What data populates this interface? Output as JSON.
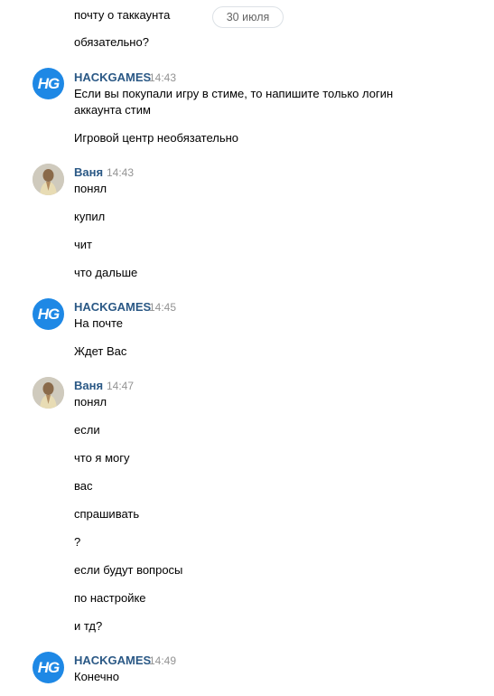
{
  "date_divider": "30 июля",
  "top_lines": [
    "почту о таккаунта",
    "обязательно?"
  ],
  "groups": [
    {
      "author": "HACKGAMES",
      "time": "14:43",
      "avatar_text": "HG",
      "messages": [
        "Если вы покупали игру в стиме, то напишите только логин",
        "аккаунта стим",
        "Игровой центр необязательно"
      ]
    },
    {
      "author": "Ваня",
      "time": "14:43",
      "messages": [
        "понял",
        "купил",
        "чит",
        "что дальше"
      ]
    },
    {
      "author": "HACKGAMES",
      "time": "14:45",
      "avatar_text": "HG",
      "messages": [
        "На почте",
        "Ждет Вас"
      ]
    },
    {
      "author": "Ваня",
      "time": "14:47",
      "messages": [
        "понял",
        "если",
        "что я могу",
        "вас",
        "спрашивать",
        "?",
        "если будут вопросы",
        "по настройке",
        "и тд?"
      ]
    },
    {
      "author": "HACKGAMES",
      "time": "14:49",
      "avatar_text": "HG",
      "messages": [
        "Конечно"
      ]
    }
  ],
  "colors": {
    "author": "#2a5885",
    "time": "#939393",
    "hg_avatar": "#1e88e5"
  }
}
